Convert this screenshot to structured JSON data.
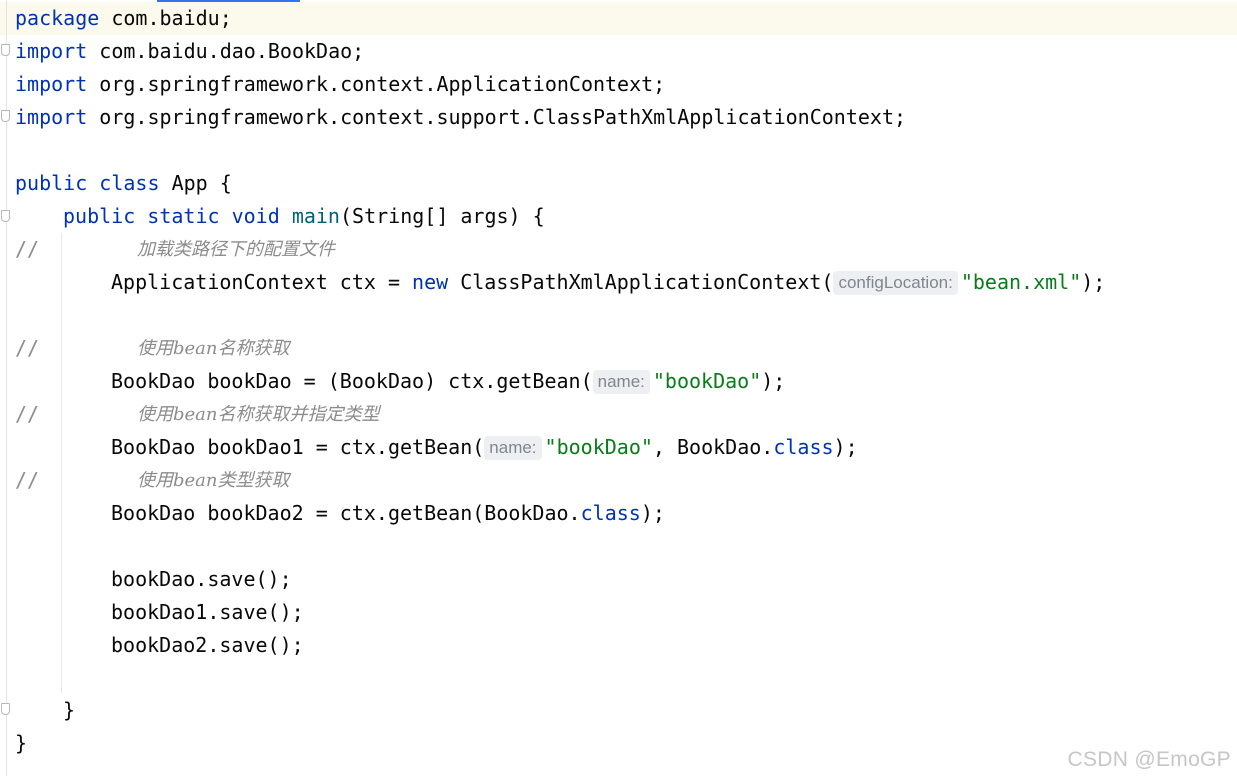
{
  "code": {
    "package_kw": "package",
    "package_name": "com.baidu;",
    "import_kw": "import",
    "imports": [
      "com.baidu.dao.BookDao;",
      "org.springframework.context.ApplicationContext;",
      "org.springframework.context.support.ClassPathXmlApplicationContext;"
    ],
    "public_kw": "public",
    "class_kw": "class",
    "class_decl": "App {",
    "static_kw": "static",
    "void_kw": "void",
    "main_name": "main",
    "main_params": "(String[] args) {",
    "comment_mark": "//",
    "comment_load": "加载类路径下的配置文件",
    "ctx_decl": "ApplicationContext ctx = ",
    "new_kw": "new",
    "ctx_ctor": " ClassPathXmlApplicationContext(",
    "hint_config": "configLocation:",
    "bean_xml": "\"bean.xml\"",
    "close_paren_semi": ");",
    "comment_by_name": "使用bean名称获取",
    "line_dao": "BookDao bookDao = (BookDao) ctx.getBean(",
    "hint_name": "name:",
    "str_bookdao": "\"bookDao\"",
    "comment_by_name_type": "使用bean名称获取并指定类型",
    "line_dao1": "BookDao bookDao1 = ctx.getBean(",
    "dao1_type": ", BookDao.",
    "class_suffix": "class",
    "comment_by_type": "使用bean类型获取",
    "line_dao2": "BookDao bookDao2 = ctx.getBean(BookDao.",
    "save_calls": [
      "bookDao.save();",
      "bookDao1.save();",
      "bookDao2.save();"
    ],
    "close_method": "}",
    "close_class": "}"
  },
  "watermark": "CSDN @EmoGP",
  "colors": {
    "keyword": "#0033b3",
    "string": "#067d17",
    "method": "#00627a",
    "comment": "#8c8c8c",
    "text": "#080808"
  }
}
